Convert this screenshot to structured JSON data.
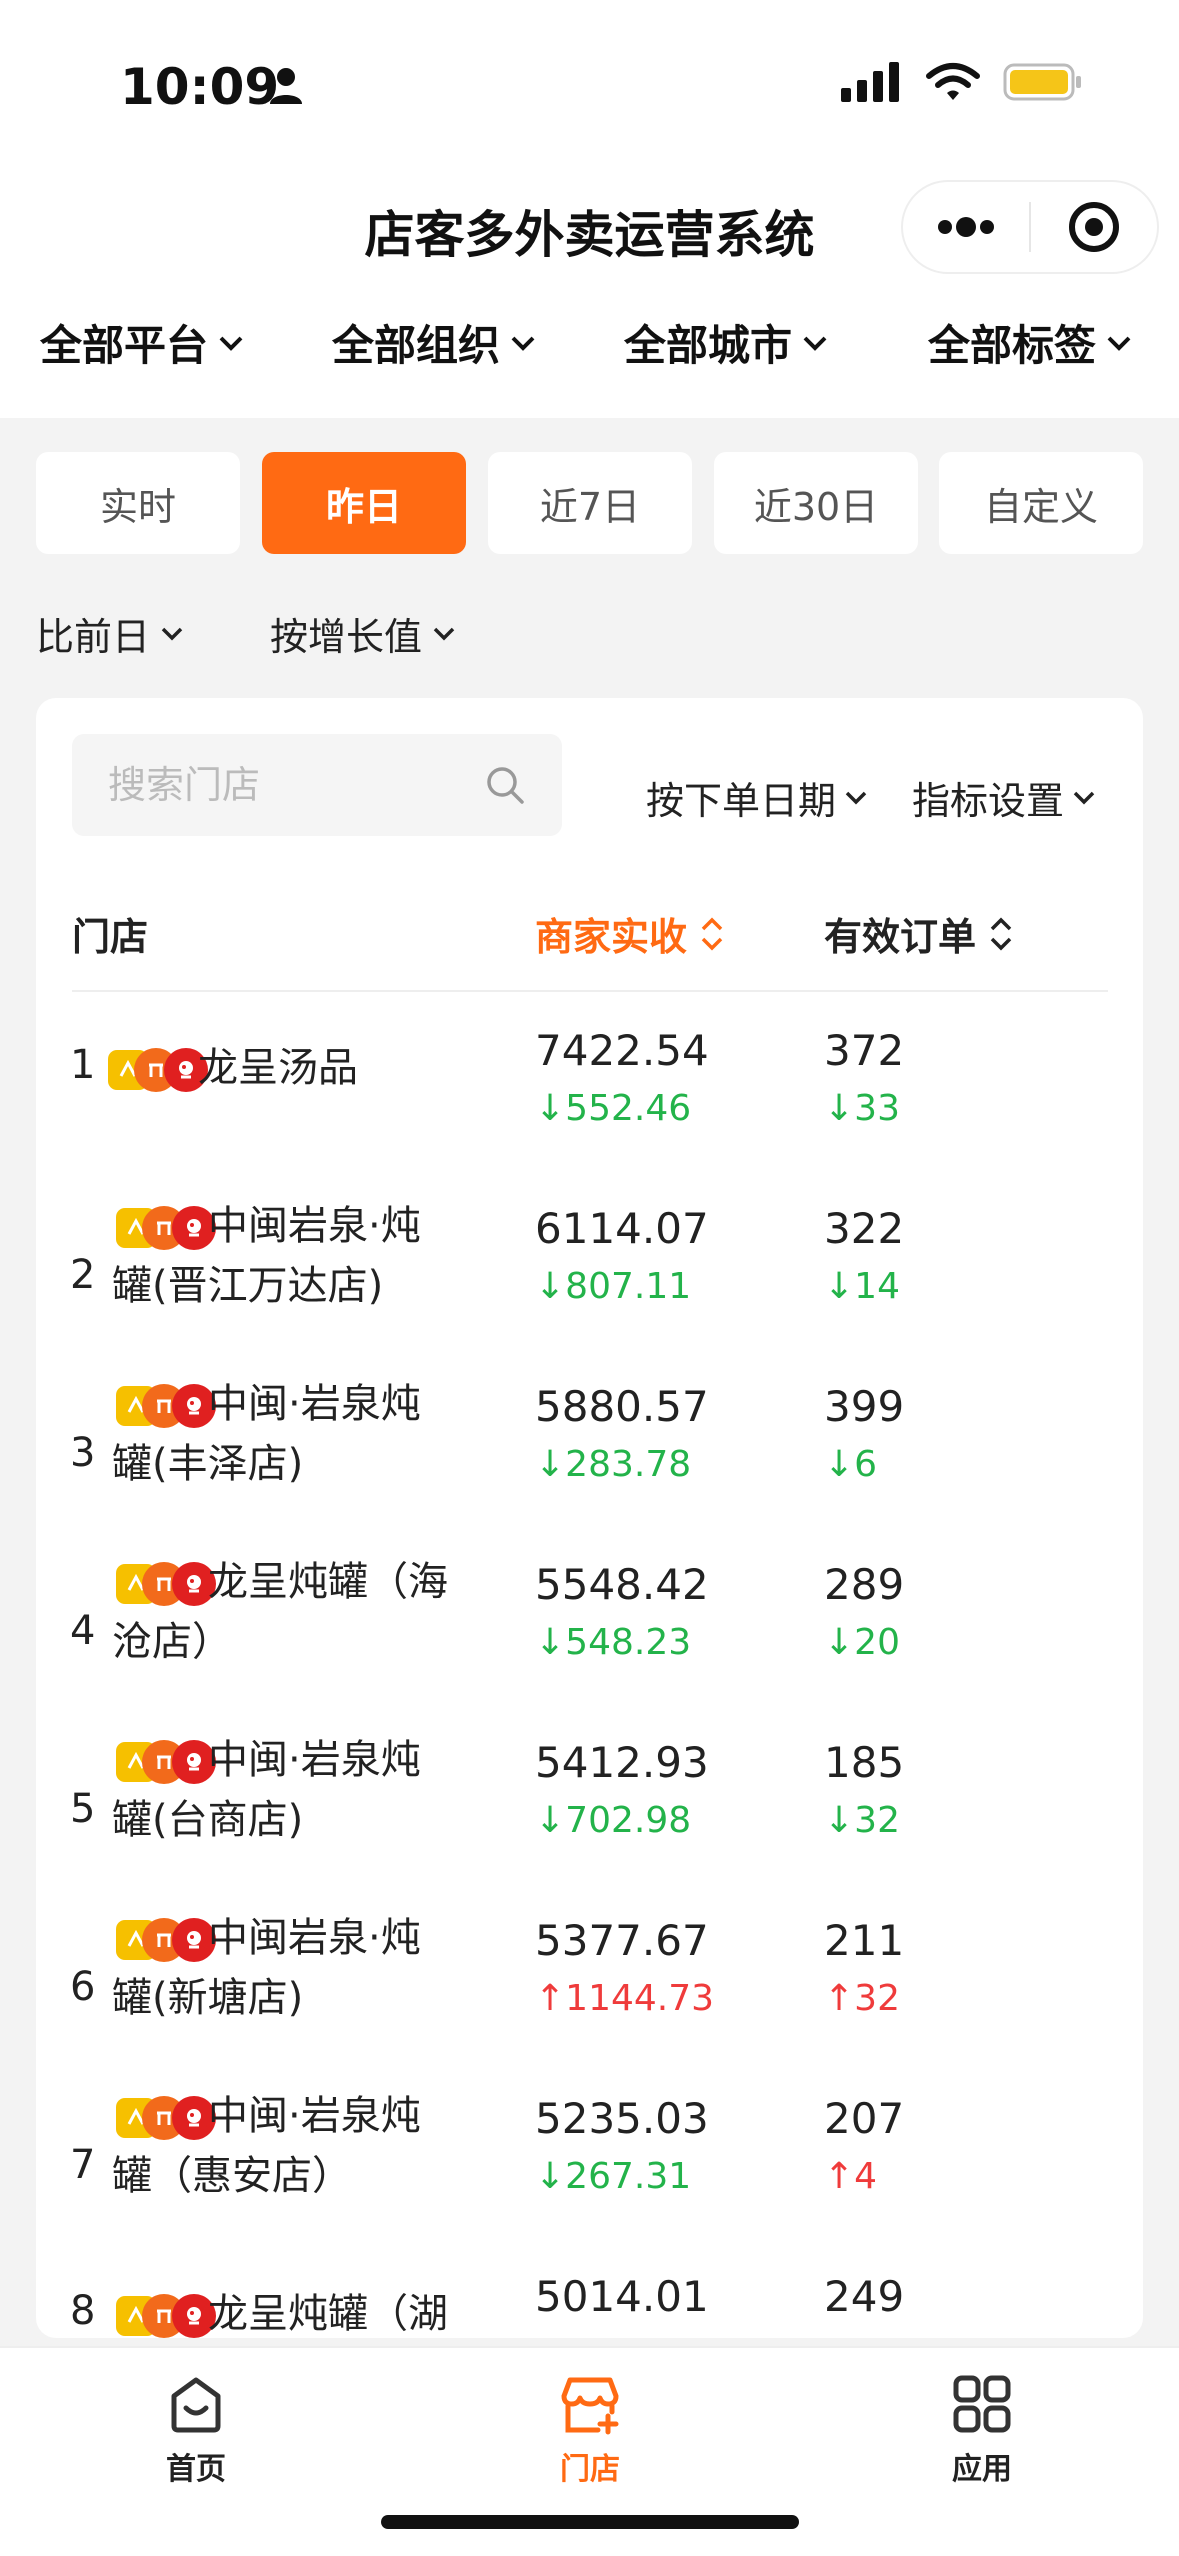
{
  "status": {
    "time": "10:09"
  },
  "header": {
    "title": "店客多外卖运营系统"
  },
  "filters": [
    "全部平台",
    "全部组织",
    "全部城市",
    "全部标签"
  ],
  "tabs": [
    {
      "label": "实时",
      "active": false
    },
    {
      "label": "昨日",
      "active": true
    },
    {
      "label": "近7日",
      "active": false
    },
    {
      "label": "近30日",
      "active": false
    },
    {
      "label": "自定义",
      "active": false
    }
  ],
  "compare": {
    "basis": "比前日",
    "sort": "按增长值"
  },
  "card": {
    "search_placeholder": "搜索门店",
    "date_option": "按下单日期",
    "metric_option": "指标设置",
    "columns": {
      "store": "门店",
      "revenue": "商家实收",
      "orders": "有效订单"
    }
  },
  "rows": [
    {
      "rank": "1",
      "name_line1": "龙呈汤品",
      "name_line2": "",
      "revenue": "7422.54",
      "revenue_delta": "↓552.46",
      "revenue_dir": "down",
      "orders": "372",
      "orders_delta": "↓33",
      "orders_dir": "down"
    },
    {
      "rank": "2",
      "name_line1": "中闽岩泉·炖",
      "name_line2": "罐(晋江万达店)",
      "revenue": "6114.07",
      "revenue_delta": "↓807.11",
      "revenue_dir": "down",
      "orders": "322",
      "orders_delta": "↓14",
      "orders_dir": "down"
    },
    {
      "rank": "3",
      "name_line1": "中闽·岩泉炖",
      "name_line2": "罐(丰泽店)",
      "revenue": "5880.57",
      "revenue_delta": "↓283.78",
      "revenue_dir": "down",
      "orders": "399",
      "orders_delta": "↓6",
      "orders_dir": "down"
    },
    {
      "rank": "4",
      "name_line1": "龙呈炖罐（海",
      "name_line2": "沧店）",
      "revenue": "5548.42",
      "revenue_delta": "↓548.23",
      "revenue_dir": "down",
      "orders": "289",
      "orders_delta": "↓20",
      "orders_dir": "down"
    },
    {
      "rank": "5",
      "name_line1": "中闽·岩泉炖",
      "name_line2": "罐(台商店)",
      "revenue": "5412.93",
      "revenue_delta": "↓702.98",
      "revenue_dir": "down",
      "orders": "185",
      "orders_delta": "↓32",
      "orders_dir": "down"
    },
    {
      "rank": "6",
      "name_line1": "中闽岩泉·炖",
      "name_line2": "罐(新塘店)",
      "revenue": "5377.67",
      "revenue_delta": "↑1144.73",
      "revenue_dir": "up",
      "orders": "211",
      "orders_delta": "↑32",
      "orders_dir": "up"
    },
    {
      "rank": "7",
      "name_line1": "中闽·岩泉炖",
      "name_line2": "罐（惠安店）",
      "revenue": "5235.03",
      "revenue_delta": "↓267.31",
      "revenue_dir": "down",
      "orders": "207",
      "orders_delta": "↑4",
      "orders_dir": "up"
    },
    {
      "rank": "8",
      "name_line1": "龙呈炖罐（湖",
      "name_line2": "",
      "revenue": "5014.01",
      "revenue_delta": "",
      "revenue_dir": "down",
      "orders": "249",
      "orders_delta": "",
      "orders_dir": "down"
    }
  ],
  "nav": [
    {
      "label": "首页",
      "icon": "home-icon",
      "active": false
    },
    {
      "label": "门店",
      "icon": "store-icon",
      "active": true
    },
    {
      "label": "应用",
      "icon": "apps-icon",
      "active": false
    }
  ],
  "colors": {
    "accent": "#ff6a13",
    "down": "#23b34a",
    "up": "#ef3b3b"
  }
}
